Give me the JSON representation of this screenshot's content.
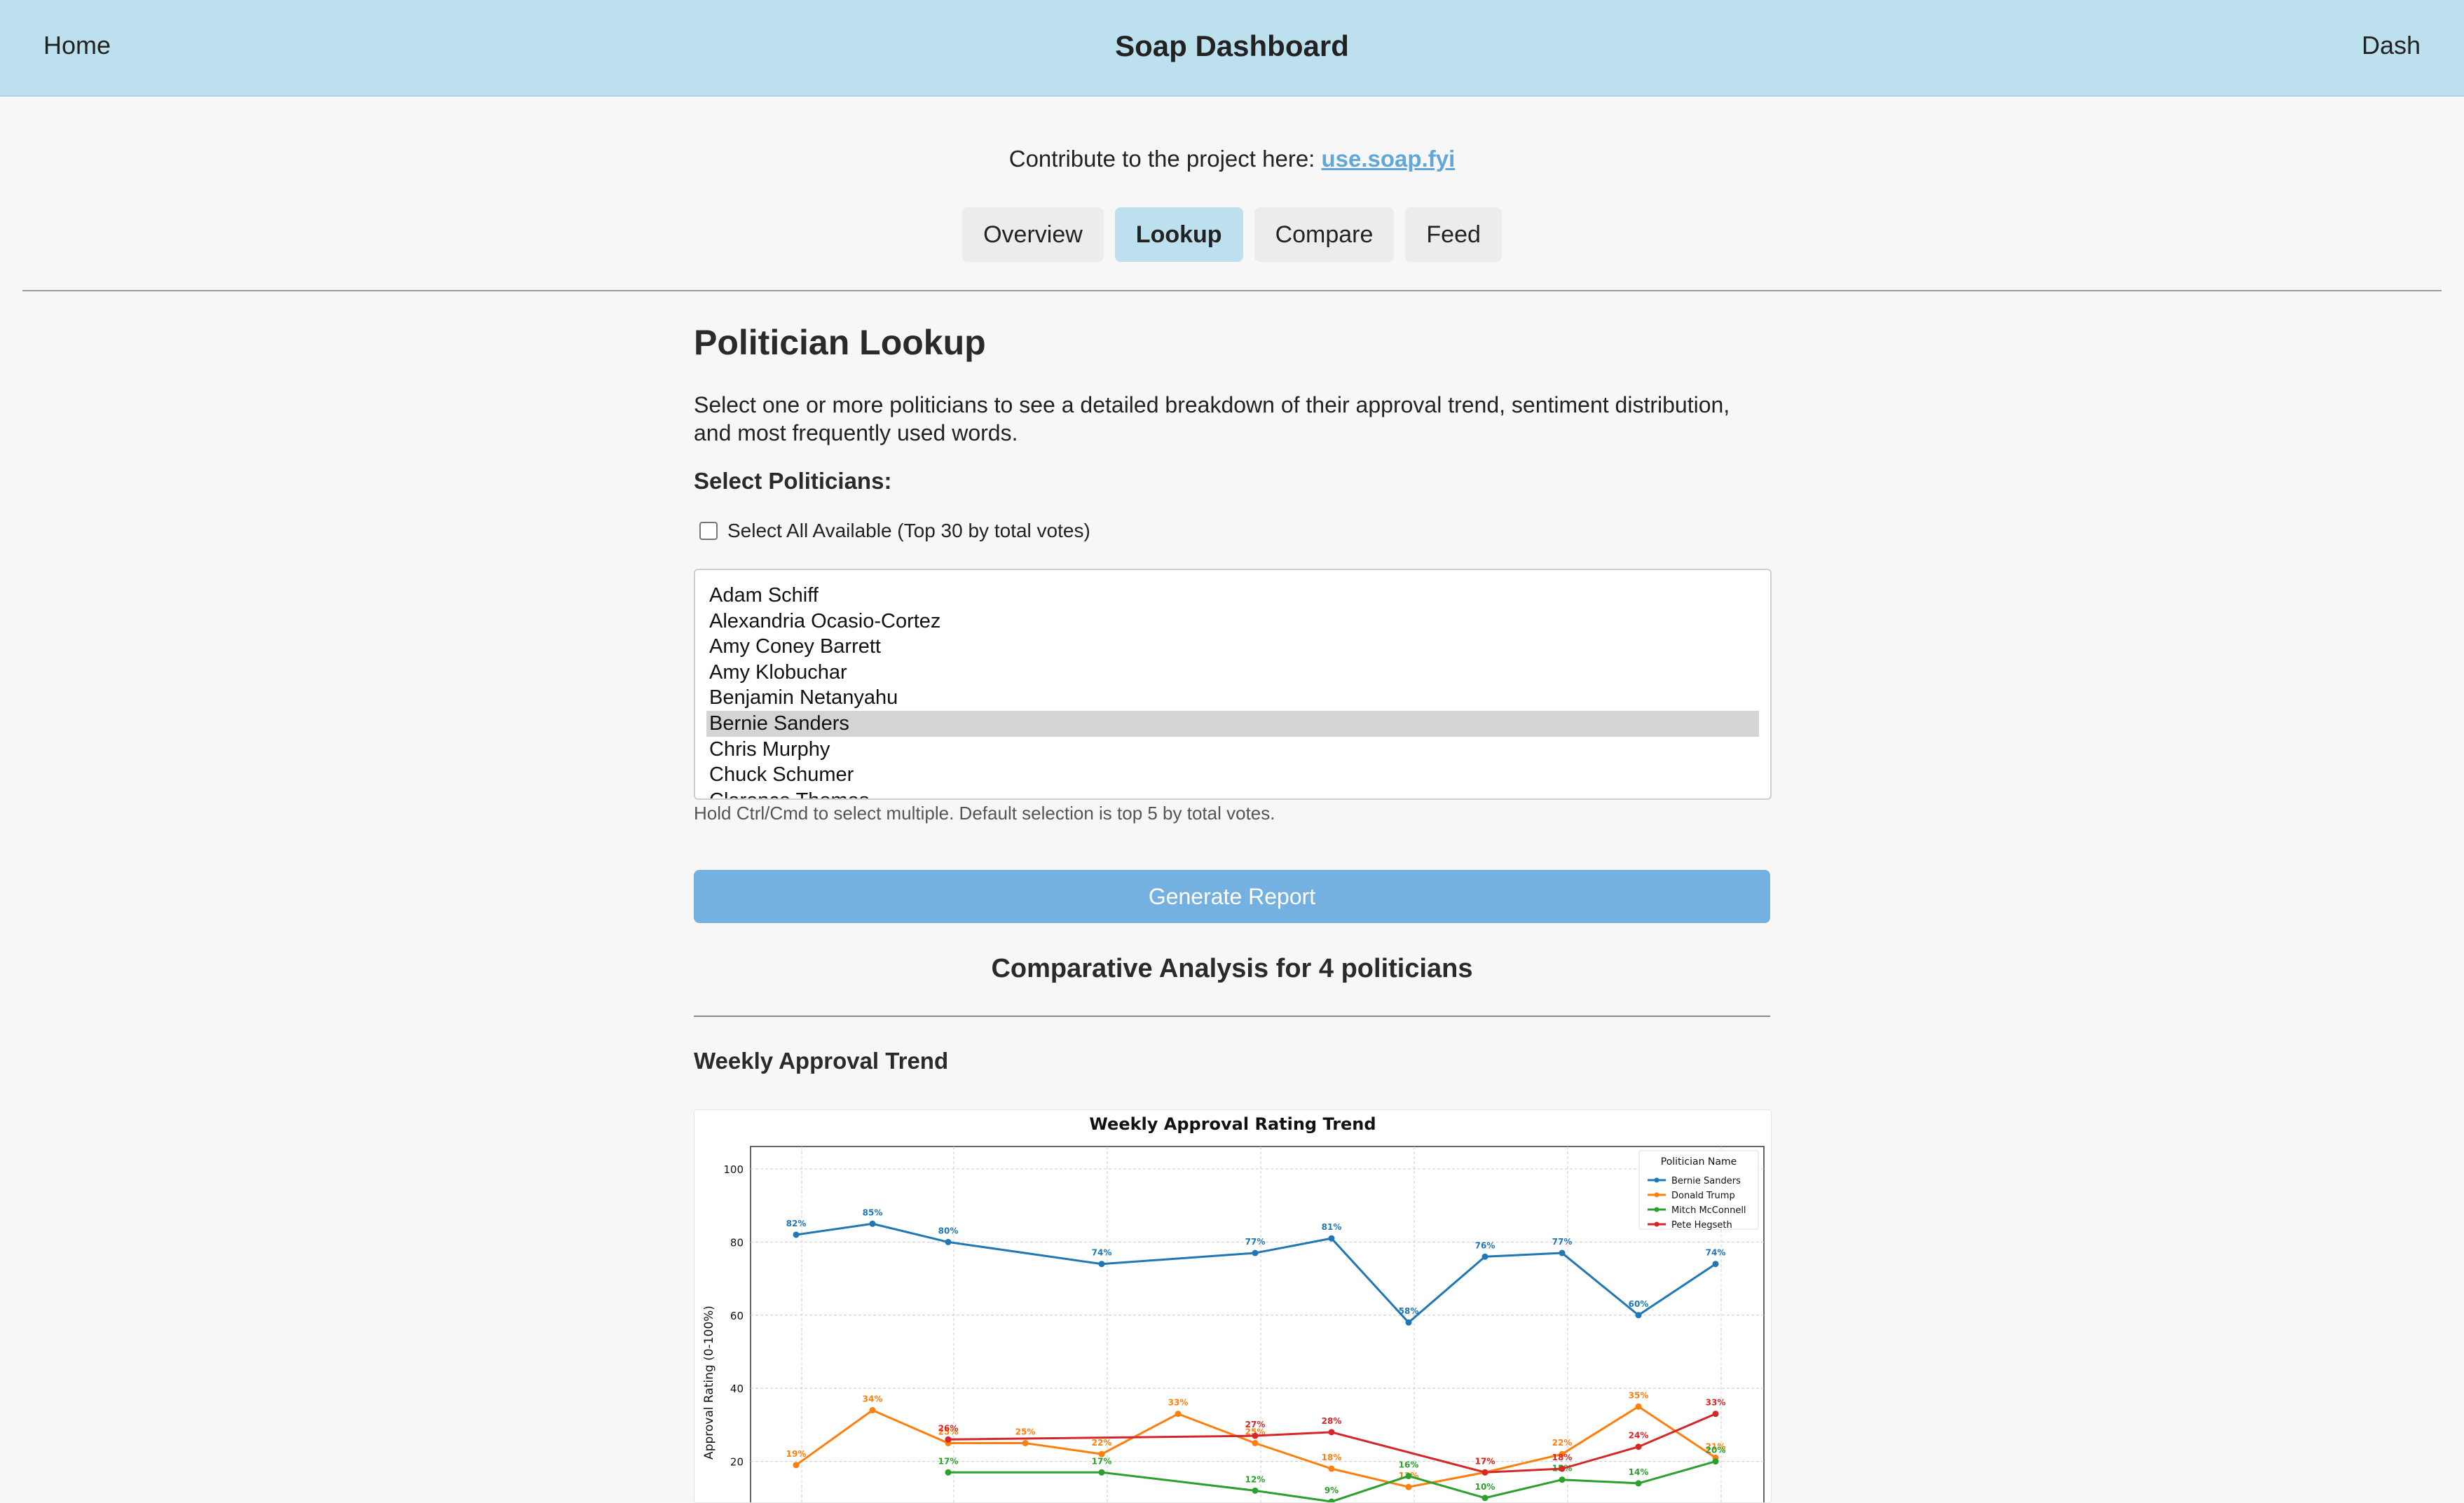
{
  "nav": {
    "home": "Home",
    "title": "Soap Dashboard",
    "dash": "Dash"
  },
  "contribute": {
    "text": "Contribute to the project here: ",
    "link": "use.soap.fyi"
  },
  "tabs": [
    {
      "label": "Overview",
      "active": false
    },
    {
      "label": "Lookup",
      "active": true
    },
    {
      "label": "Compare",
      "active": false
    },
    {
      "label": "Feed",
      "active": false
    }
  ],
  "lookup": {
    "title": "Politician Lookup",
    "description": "Select one or more politicians to see a detailed breakdown of their approval trend, sentiment distribution, and most frequently used words.",
    "select_label": "Select Politicians:",
    "select_all_label": "Select All Available (Top 30 by total votes)",
    "options": [
      "Adam Schiff",
      "Alexandria Ocasio-Cortez",
      "Amy Coney Barrett",
      "Amy Klobuchar",
      "Benjamin Netanyahu",
      "Bernie Sanders",
      "Chris Murphy",
      "Chuck Schumer",
      "Clarence Thomas"
    ],
    "selected_option": "Bernie Sanders",
    "hint": "Hold Ctrl/Cmd to select multiple. Default selection is top 5 by total votes.",
    "generate_label": "Generate Report",
    "analysis_title": "Comparative Analysis for 4 politicians",
    "trend_title": "Weekly Approval Trend"
  },
  "colors": {
    "topbar": "#bde0ef",
    "button": "#75b1e0",
    "link": "#5fa8d9"
  },
  "chart_data": {
    "type": "line",
    "title": "Weekly Approval Rating Trend",
    "ylabel": "Approval Rating (0-100%)",
    "xlabel": "",
    "ylim": [
      0,
      100
    ],
    "yticks": [
      20,
      40,
      60,
      80,
      100
    ],
    "grid": true,
    "legend_title": "Politician Name",
    "legend_position": "top-right",
    "x": [
      0,
      1,
      2,
      3,
      4,
      5,
      6,
      7,
      8,
      9,
      10,
      11,
      12
    ],
    "series": [
      {
        "name": "Bernie Sanders",
        "color": "#1f77b4",
        "values": [
          82,
          85,
          80,
          null,
          74,
          null,
          77,
          81,
          58,
          76,
          77,
          60,
          74
        ]
      },
      {
        "name": "Donald Trump",
        "color": "#ff7f0e",
        "values": [
          19,
          34,
          25,
          25,
          22,
          33,
          25,
          18,
          13,
          17,
          22,
          35,
          21
        ]
      },
      {
        "name": "Mitch McConnell",
        "color": "#2ca02c",
        "values": [
          null,
          null,
          17,
          null,
          17,
          null,
          12,
          9,
          16,
          10,
          15,
          14,
          20
        ]
      },
      {
        "name": "Pete Hegseth",
        "color": "#d62728",
        "values": [
          null,
          null,
          26,
          null,
          null,
          null,
          27,
          28,
          null,
          17,
          18,
          24,
          33
        ]
      }
    ]
  }
}
